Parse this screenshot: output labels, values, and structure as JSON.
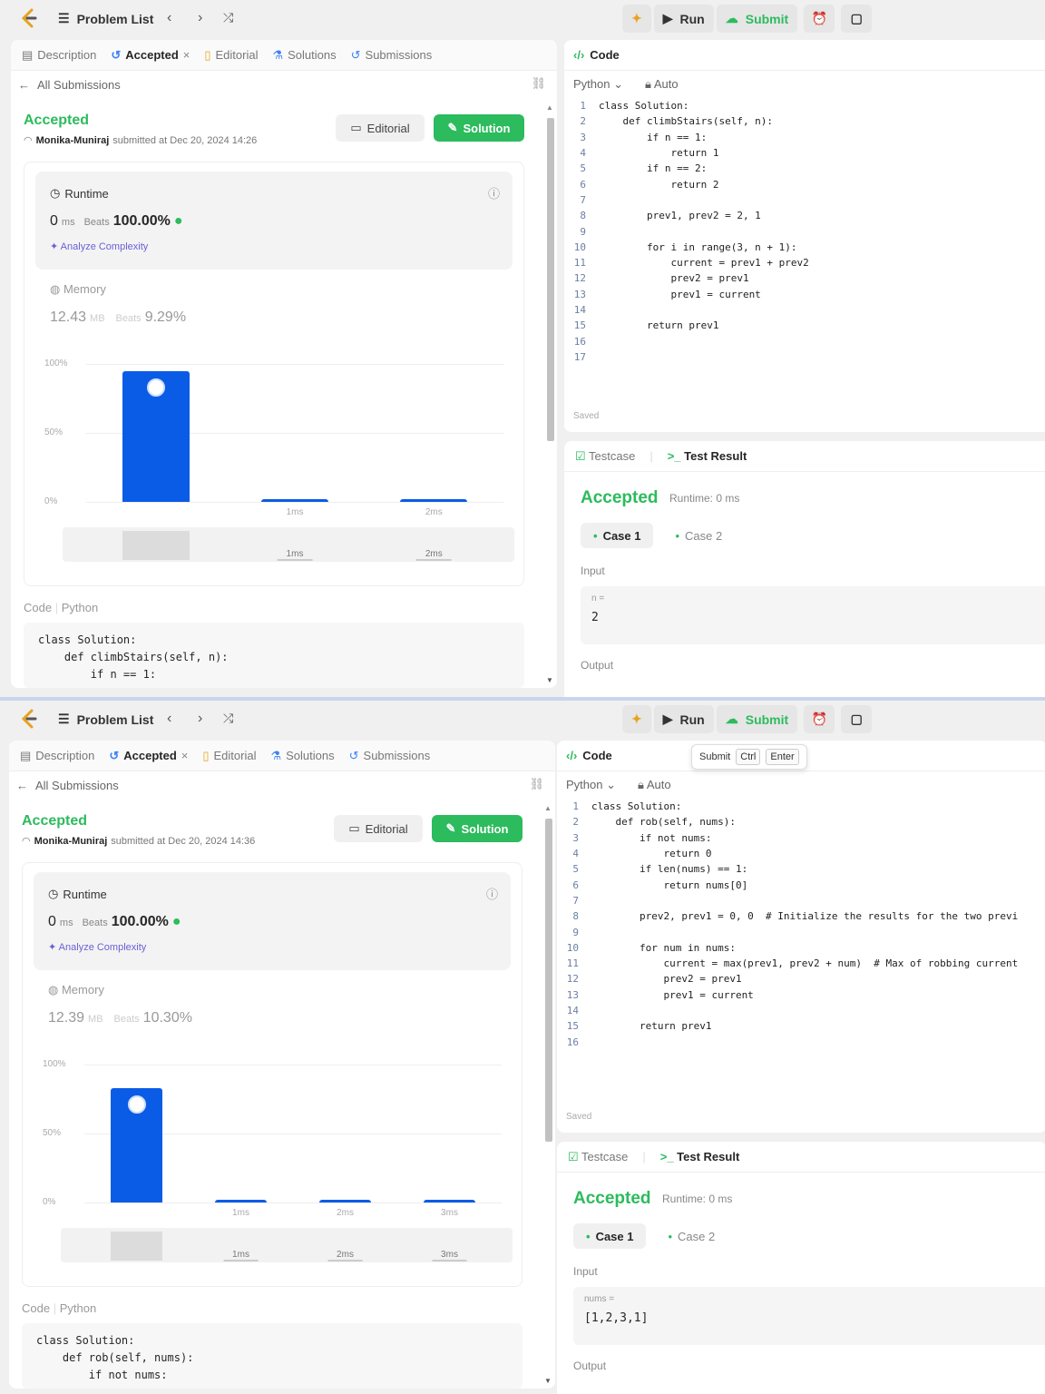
{
  "shots": [
    {
      "nav": {
        "problem_list": "Problem List",
        "run": "Run",
        "submit": "Submit"
      },
      "left_tabs": [
        "Description",
        "Accepted",
        "Editorial",
        "Solutions",
        "Submissions"
      ],
      "all_submissions": "All Submissions",
      "status": "Accepted",
      "user": "Monika-Muniraj",
      "submitted_text": "submitted at Dec 20, 2024 14:26",
      "editorial_btn": "Editorial",
      "solution_btn": "Solution",
      "runtime": {
        "label": "Runtime",
        "value": "0",
        "unit": "ms",
        "beats_label": "Beats",
        "beats": "100.00%",
        "analyze": "Analyze Complexity"
      },
      "memory": {
        "label": "Memory",
        "value": "12.43",
        "unit": "MB",
        "beats_label": "Beats",
        "beats": "9.29%"
      },
      "chart_data": {
        "type": "bar",
        "categories": [
          "0ms",
          "1ms",
          "2ms"
        ],
        "values": [
          95,
          2,
          2
        ],
        "ylim": [
          0,
          100
        ],
        "yticks": [
          "100%",
          "50%",
          "0%"
        ],
        "xlabels": [
          "",
          "1ms",
          "2ms"
        ],
        "brush_labels": [
          "1ms",
          "2ms"
        ]
      },
      "code_label": "Code",
      "code_lang": "Python",
      "code_preview": [
        "class Solution:",
        "    def climbStairs(self, n):",
        "        if n == 1:"
      ],
      "right": {
        "code_tab": "Code",
        "lang": "Python",
        "auto": "Auto",
        "saved": "Saved",
        "code": [
          "class Solution:",
          "    def climbStairs(self, n):",
          "        if n == 1:",
          "            return 1",
          "        if n == 2:",
          "            return 2",
          "",
          "        prev1, prev2 = 2, 1",
          "",
          "        for i in range(3, n + 1):",
          "            current = prev1 + prev2",
          "            prev2 = prev1",
          "            prev1 = current",
          "",
          "        return prev1",
          "",
          ""
        ]
      },
      "result": {
        "testcase": "Testcase",
        "test_result": "Test Result",
        "status": "Accepted",
        "runtime": "Runtime: 0 ms",
        "cases": [
          "Case 1",
          "Case 2"
        ],
        "input_label": "Input",
        "var": "n =",
        "value": "2",
        "output_label": "Output"
      }
    },
    {
      "nav": {
        "problem_list": "Problem List",
        "run": "Run",
        "submit": "Submit"
      },
      "tooltip": {
        "label": "Submit",
        "k1": "Ctrl",
        "k2": "Enter"
      },
      "left_tabs": [
        "Description",
        "Accepted",
        "Editorial",
        "Solutions",
        "Submissions"
      ],
      "all_submissions": "All Submissions",
      "status": "Accepted",
      "user": "Monika-Muniraj",
      "submitted_text": "submitted at Dec 20, 2024 14:36",
      "editorial_btn": "Editorial",
      "solution_btn": "Solution",
      "runtime": {
        "label": "Runtime",
        "value": "0",
        "unit": "ms",
        "beats_label": "Beats",
        "beats": "100.00%",
        "analyze": "Analyze Complexity"
      },
      "memory": {
        "label": "Memory",
        "value": "12.39",
        "unit": "MB",
        "beats_label": "Beats",
        "beats": "10.30%"
      },
      "chart_data": {
        "type": "bar",
        "categories": [
          "0ms",
          "1ms",
          "2ms",
          "3ms"
        ],
        "values": [
          83,
          2,
          2,
          2
        ],
        "ylim": [
          0,
          100
        ],
        "yticks": [
          "100%",
          "50%",
          "0%"
        ],
        "xlabels": [
          "",
          "1ms",
          "2ms",
          "3ms"
        ],
        "brush_labels": [
          "1ms",
          "2ms",
          "3ms"
        ]
      },
      "code_label": "Code",
      "code_lang": "Python",
      "code_preview": [
        "class Solution:",
        "    def rob(self, nums):",
        "        if not nums:"
      ],
      "right": {
        "code_tab": "Code",
        "lang": "Python",
        "auto": "Auto",
        "saved": "Saved",
        "code": [
          "class Solution:",
          "    def rob(self, nums):",
          "        if not nums:",
          "            return 0",
          "        if len(nums) == 1:",
          "            return nums[0]",
          "",
          "        prev2, prev1 = 0, 0  # Initialize the results for the two previ",
          "",
          "        for num in nums:",
          "            current = max(prev1, prev2 + num)  # Max of robbing current",
          "            prev2 = prev1",
          "            prev1 = current",
          "",
          "        return prev1",
          ""
        ]
      },
      "result": {
        "testcase": "Testcase",
        "test_result": "Test Result",
        "status": "Accepted",
        "runtime": "Runtime: 0 ms",
        "cases": [
          "Case 1",
          "Case 2"
        ],
        "input_label": "Input",
        "var": "nums =",
        "value": "[1,2,3,1]",
        "output_label": "Output"
      }
    }
  ]
}
